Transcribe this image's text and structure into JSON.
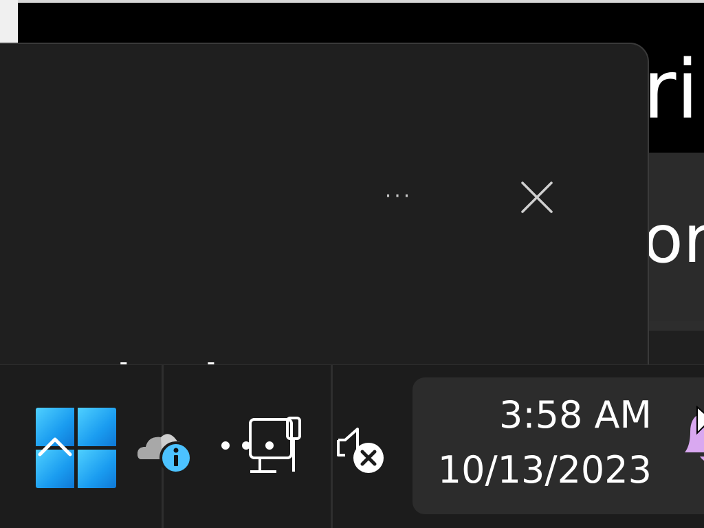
{
  "background_window": {
    "title_fragment": "ri",
    "panel_fragment": "or"
  },
  "flyout": {
    "more_label": "···",
    "heading": "n Windows"
  },
  "taskbar": {
    "clock": {
      "time": "3:58 AM",
      "date": "10/13/2023"
    },
    "icons": {
      "start": "windows-start-icon",
      "onedrive": "onedrive-info-icon",
      "network": "network-ethernet-icon",
      "volume": "volume-muted-icon",
      "notifications": "bell-icon"
    }
  },
  "colors": {
    "flyout_bg": "#1f1f1f",
    "taskbar_bg": "#1c1c1c",
    "clock_bg": "#2c2c2c",
    "accent_blue": "#1a9cf0",
    "info_badge": "#4cc2ff",
    "bell": "#d9a8f0"
  }
}
